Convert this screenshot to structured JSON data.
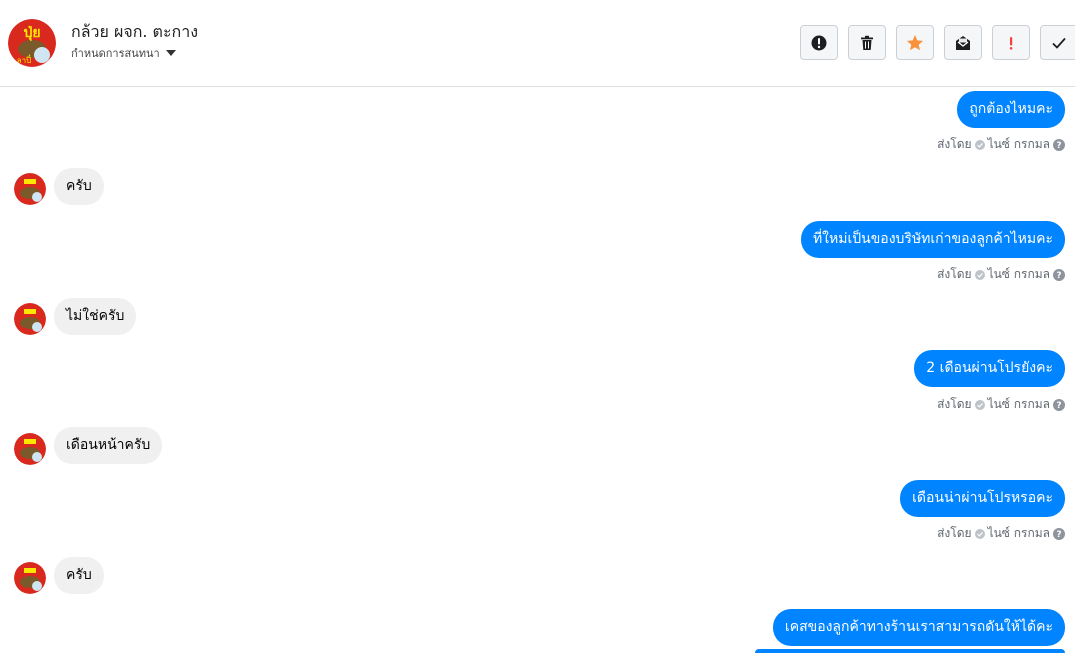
{
  "header": {
    "contact_name": "กล้วย ผจก. ตะกาง",
    "settings_label": "กำหนดการสนทนา",
    "avatar_text": "ปุ่ย",
    "avatar_subtext": "ลาปี๋"
  },
  "toolbar": {
    "buttons": [
      {
        "icon": "alert-circle-icon"
      },
      {
        "icon": "trash-icon"
      },
      {
        "icon": "star-icon",
        "color": "#f7923b"
      },
      {
        "icon": "mark-unread-icon"
      },
      {
        "icon": "spam-icon",
        "color": "#fa3e3e"
      },
      {
        "icon": "check-icon"
      }
    ]
  },
  "messages": [
    {
      "direction": "out",
      "text": "ถูกต้องไหมคะ",
      "sent_by": "ส่งโดย",
      "sender": "ไนซ์ กรกมล"
    },
    {
      "direction": "in",
      "text": "ครับ"
    },
    {
      "direction": "out",
      "text": "ที่ใหม่เป็นของบริษัทเก่าของลูกค้าไหมคะ",
      "sent_by": "ส่งโดย",
      "sender": "ไนซ์ กรกมล"
    },
    {
      "direction": "in",
      "text": "ไม่ใช่ครับ"
    },
    {
      "direction": "out",
      "text": "2 เดือนผ่านโปรยังคะ",
      "sent_by": "ส่งโดย",
      "sender": "ไนซ์ กรกมล"
    },
    {
      "direction": "in",
      "text": "เดือนหน้าครับ"
    },
    {
      "direction": "out",
      "text": "เดือนน่าผ่านโปรหรอคะ",
      "sent_by": "ส่งโดย",
      "sender": "ไนซ์ กรกมล"
    },
    {
      "direction": "in",
      "text": "ครับ"
    },
    {
      "direction": "out",
      "text": "เคสของลูกค้าทางร้านเราสามารถดันให้ได้คะ"
    }
  ],
  "colors": {
    "outgoing_bubble": "#0084ff",
    "incoming_bubble": "#f0f0f0"
  }
}
